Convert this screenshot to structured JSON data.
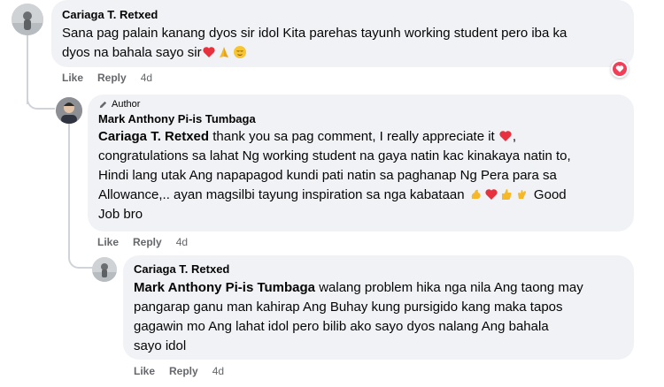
{
  "comments": [
    {
      "author": "Cariaga T. Retxed",
      "text_parts": {
        "line1": "Sana pag palain kanang dyos sir idol Kita parehas tayunh working student pero iba ka",
        "line2": "dyos na bahala sayo sir"
      },
      "actions": {
        "like": "Like",
        "reply": "Reply",
        "time": "4d"
      },
      "reaction": "heart-reaction-icon"
    },
    {
      "badge": "Author",
      "author": "Mark Anthony Pi-is Tumbaga",
      "mention": "Cariaga T. Retxed",
      "text_parts": {
        "line1": " thank you sa pag comment, I really appreciate it ",
        "line2": "congratulations sa lahat Ng working student na gaya natin kac kinakaya natin to,",
        "line3": "Hindi lang utak Ang napapagod kundi pati natin sa paghanap Ng Pera para sa",
        "line4": "Allowance,.. ayan magsilbi tayung inspiration sa nga kabataan ",
        "line4_end": " Good",
        "line5": "Job bro"
      },
      "actions": {
        "like": "Like",
        "reply": "Reply",
        "time": "4d"
      }
    },
    {
      "author": "Cariaga T. Retxed",
      "mention": "Mark Anthony Pi-is Tumbaga",
      "text_parts": {
        "line1": " walang problem hika nga nila Ang taong may",
        "line2": "pangarap ganu man kahirap Ang Buhay kung pursigido kang maka tapos",
        "line3": "gagawin mo Ang lahat idol pero bilib ako sayo dyos nalang Ang bahala",
        "line4": "sayo idol"
      },
      "actions": {
        "like": "Like",
        "reply": "Reply",
        "time": "4d"
      }
    }
  ],
  "colors": {
    "bubble": "#f0f2f5",
    "secondary_text": "#65676b",
    "heart": "#f33e58"
  }
}
